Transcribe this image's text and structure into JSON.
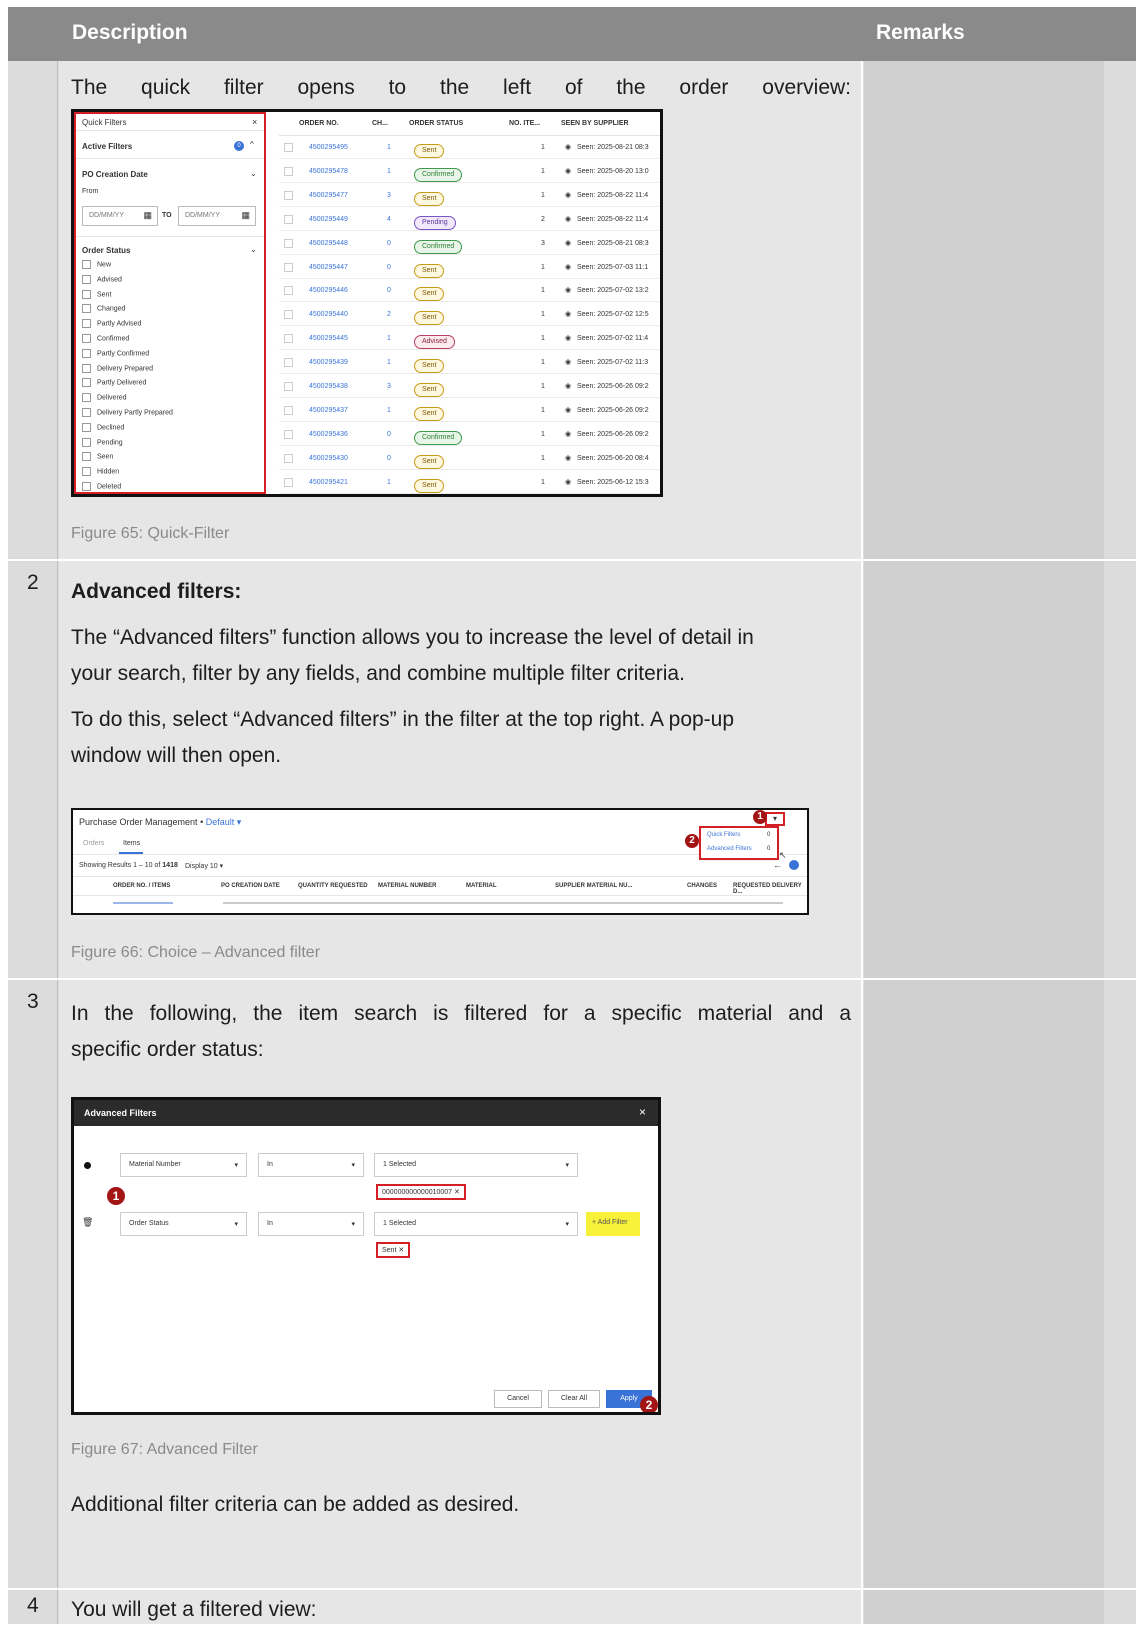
{
  "header": {
    "description": "Description",
    "remarks": "Remarks"
  },
  "row1": {
    "text": "The quick filter opens to the left of the order overview:",
    "caption": "Figure 65: Quick-Filter",
    "panel": {
      "title": "Quick Filters",
      "active_filters": "Active Filters",
      "active_count": "0",
      "po_creation_date": "PO Creation Date",
      "from": "From",
      "date_placeholder": "DD/MM/YY",
      "to": "TO",
      "order_status": "Order Status",
      "statuses": [
        "New",
        "Advised",
        "Sent",
        "Changed",
        "Partly Advised",
        "Confirmed",
        "Partly Confirmed",
        "Delivery Prepared",
        "Partly Delivered",
        "Delivered",
        "Delivery Partly Prepared",
        "Declined",
        "Pending",
        "Seen",
        "Hidden",
        "Deleted"
      ]
    },
    "table": {
      "columns": [
        "ORDER NO.",
        "CH...",
        "ORDER STATUS",
        "NO. ITE...",
        "SEEN BY SUPPLIER"
      ],
      "rows": [
        {
          "order": "4500295495",
          "ch": "1",
          "status": "Sent",
          "kind": "sent",
          "items": "1",
          "seen": "Seen: 2025-08-21 08:3"
        },
        {
          "order": "4500295478",
          "ch": "1",
          "status": "Confirmed",
          "kind": "confirmed",
          "items": "1",
          "seen": "Seen: 2025-08-20 13:0"
        },
        {
          "order": "4500295477",
          "ch": "3",
          "status": "Sent",
          "kind": "sent",
          "items": "1",
          "seen": "Seen: 2025-08-22 11:4"
        },
        {
          "order": "4500295449",
          "ch": "4",
          "status": "Pending",
          "kind": "pending",
          "items": "2",
          "seen": "Seen: 2025-08-22 11:4"
        },
        {
          "order": "4500295448",
          "ch": "0",
          "status": "Confirmed",
          "kind": "confirmed",
          "items": "3",
          "seen": "Seen: 2025-08-21 08:3"
        },
        {
          "order": "4500295447",
          "ch": "0",
          "status": "Sent",
          "kind": "sent",
          "items": "1",
          "seen": "Seen: 2025-07-03 11:1"
        },
        {
          "order": "4500295446",
          "ch": "0",
          "status": "Sent",
          "kind": "sent",
          "items": "1",
          "seen": "Seen: 2025-07-02 13:2"
        },
        {
          "order": "4500295440",
          "ch": "2",
          "status": "Sent",
          "kind": "sent",
          "items": "1",
          "seen": "Seen: 2025-07-02 12:5"
        },
        {
          "order": "4500295445",
          "ch": "1",
          "status": "Advised",
          "kind": "advised",
          "items": "1",
          "seen": "Seen: 2025-07-02 11:4"
        },
        {
          "order": "4500295439",
          "ch": "1",
          "status": "Sent",
          "kind": "sent",
          "items": "1",
          "seen": "Seen: 2025-07-02 11:3"
        },
        {
          "order": "4500295438",
          "ch": "3",
          "status": "Sent",
          "kind": "sent",
          "items": "1",
          "seen": "Seen: 2025-06-26 09:2"
        },
        {
          "order": "4500295437",
          "ch": "1",
          "status": "Sent",
          "kind": "sent",
          "items": "1",
          "seen": "Seen: 2025-06-26 09:2"
        },
        {
          "order": "4500295436",
          "ch": "0",
          "status": "Confirmed",
          "kind": "confirmed",
          "items": "1",
          "seen": "Seen: 2025-06-26 09:2"
        },
        {
          "order": "4500295430",
          "ch": "0",
          "status": "Sent",
          "kind": "sent",
          "items": "1",
          "seen": "Seen: 2025-06-20 08:4"
        },
        {
          "order": "4500295421",
          "ch": "1",
          "status": "Sent",
          "kind": "sent",
          "items": "1",
          "seen": "Seen: 2025-06-12 15:3"
        }
      ]
    }
  },
  "row2": {
    "num": "2",
    "heading": "Advanced filters:",
    "para1_line1": "The “Advanced filters” function allows you to increase the level of detail in",
    "para1_line2": "your search, filter by any fields, and combine multiple filter criteria.",
    "para2_line1": "To do this, select “Advanced filters” in the filter at the top right. A pop-up",
    "para2_line2": "window will then open.",
    "caption": "Figure 66: Choice – Advanced filter",
    "shot": {
      "title": "Purchase Order Management",
      "view": "Default",
      "tab_orders": "Orders",
      "tab_items": "Items",
      "results_prefix": "Showing Results 1 – 10 of ",
      "results_total": "1418",
      "display": "Display 10",
      "menu_quick": "Quick Filters",
      "menu_quick_count": "0",
      "menu_adv": "Advanced Filters",
      "menu_adv_count": "0",
      "columns": [
        "ORDER NO. / ITEMS",
        "PO CREATION DATE",
        "QUANTITY REQUESTED",
        "MATERIAL NUMBER",
        "MATERIAL",
        "SUPPLIER MATERIAL NU...",
        "CHANGES",
        "REQUESTED DELIVERY D..."
      ],
      "badge1": "1",
      "badge2": "2"
    }
  },
  "row3": {
    "num": "3",
    "line1": "In the following, the item search is filtered for a specific material and a",
    "line2": "specific order status:",
    "caption": "Figure 67: Advanced Filter",
    "after": "Additional filter criteria can be added as desired.",
    "dialog": {
      "title": "Advanced Filters",
      "field1": "Material Number",
      "op1": "In",
      "sel1": "1 Selected",
      "chip1": "000000000000010007",
      "field2": "Order Status",
      "op2": "In",
      "sel2": "1 Selected",
      "chip2": "Sent",
      "add": "+ Add Filter",
      "cancel": "Cancel",
      "clear": "Clear All",
      "apply": "Apply",
      "badge1": "1",
      "badge2": "2"
    }
  },
  "row4": {
    "num": "4",
    "text": "You will get a filtered view:"
  }
}
